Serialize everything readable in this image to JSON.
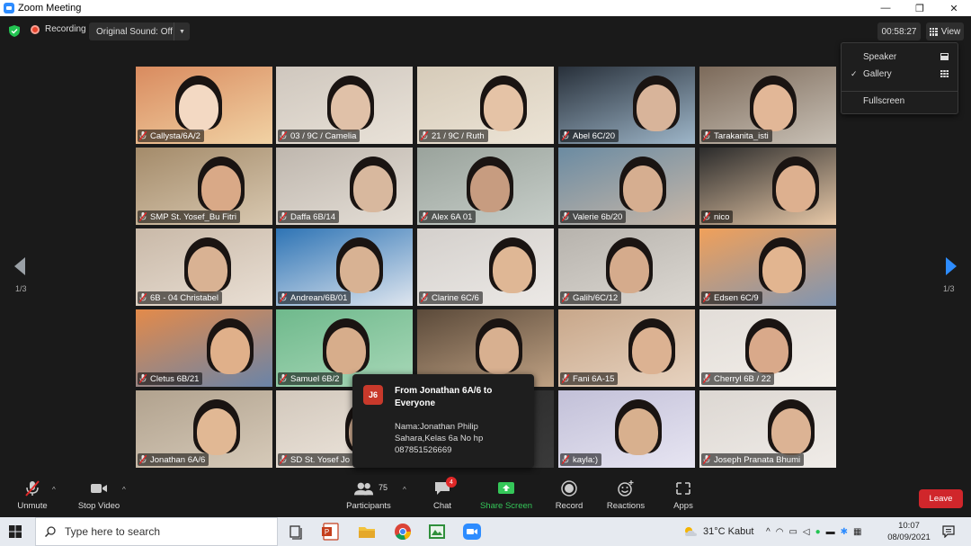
{
  "window": {
    "title": "Zoom Meeting",
    "minimize": "—",
    "restore": "❐",
    "close": "✕"
  },
  "topbar": {
    "recording_label": "Recording",
    "original_sound": "Original Sound: Off",
    "timer": "00:58:27",
    "view_label": "View"
  },
  "view_menu": {
    "items": [
      {
        "label": "Speaker",
        "checked": false
      },
      {
        "label": "Gallery",
        "checked": true
      },
      {
        "label": "Fullscreen",
        "checked": false
      }
    ]
  },
  "pagination": {
    "left": "1/3",
    "right": "1/3"
  },
  "participants": [
    {
      "name": "Callysta/6A/2"
    },
    {
      "name": "03 / 9C / Camelia",
      "active": true
    },
    {
      "name": "21 / 9C / Ruth"
    },
    {
      "name": "Abel 6C/20"
    },
    {
      "name": "Tarakanita_isti"
    },
    {
      "name": "SMP St. Yosef_Bu Fitri"
    },
    {
      "name": "Daffa 6B/14"
    },
    {
      "name": "Alex 6A 01"
    },
    {
      "name": "Valerie 6b/20"
    },
    {
      "name": "nico"
    },
    {
      "name": "6B - 04 Christabel"
    },
    {
      "name": "Andrean/6B/01"
    },
    {
      "name": "Clarine 6C/6"
    },
    {
      "name": "Galih/6C/12"
    },
    {
      "name": "Edsen 6C/9"
    },
    {
      "name": "Cletus 6B/21"
    },
    {
      "name": "Samuel 6B/2"
    },
    {
      "name": ""
    },
    {
      "name": "Fani 6A-15"
    },
    {
      "name": "Cherryl 6B / 22"
    },
    {
      "name": "Jonathan 6A/6"
    },
    {
      "name": "SD St. Yosef Jo"
    },
    {
      "name": ""
    },
    {
      "name": "kayla:)"
    },
    {
      "name": "Joseph Pranata Bhumi"
    }
  ],
  "chat_popup": {
    "avatar_initials": "J6",
    "from": "From Jonathan 6A/6 to Everyone",
    "message_line1": "Nama:Jonathan Philip",
    "message_line2": "Sahara,Kelas 6a No hp",
    "message_line3": "087851526669"
  },
  "toolbar": {
    "unmute": "Unmute",
    "stop_video": "Stop Video",
    "participants": "Participants",
    "participants_count": "75",
    "chat": "Chat",
    "chat_badge": "4",
    "share_screen": "Share Screen",
    "record": "Record",
    "reactions": "Reactions",
    "apps": "Apps",
    "leave": "Leave"
  },
  "taskbar": {
    "search_placeholder": "Type here to search",
    "weather": "31°C  Kabut",
    "time": "10:07",
    "date": "08/09/2021"
  },
  "colors": {
    "accent_blue": "#2d8cff",
    "leave_red": "#d0262b",
    "share_green": "#35c759",
    "active_speaker": "#f4f29c"
  }
}
